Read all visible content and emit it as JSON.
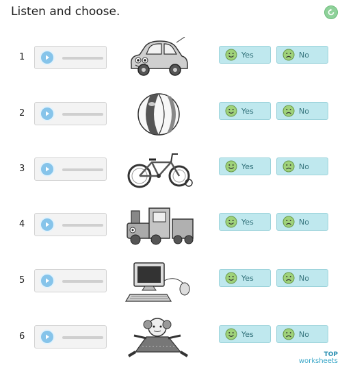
{
  "header": {
    "title": "Listen and choose."
  },
  "choices": {
    "yes_label": "Yes",
    "no_label": "No"
  },
  "rows": [
    {
      "number": "1",
      "picture": "car"
    },
    {
      "number": "2",
      "picture": "beach-ball"
    },
    {
      "number": "3",
      "picture": "bicycle"
    },
    {
      "number": "4",
      "picture": "toy-train"
    },
    {
      "number": "5",
      "picture": "computer"
    },
    {
      "number": "6",
      "picture": "doll"
    }
  ],
  "footer": {
    "logo_top": "TOP",
    "logo_bottom": "worksheets"
  },
  "colors": {
    "choice_bg": "#bfe8ee",
    "play_button": "#86c4ea",
    "reset_button": "#8fd19a"
  }
}
